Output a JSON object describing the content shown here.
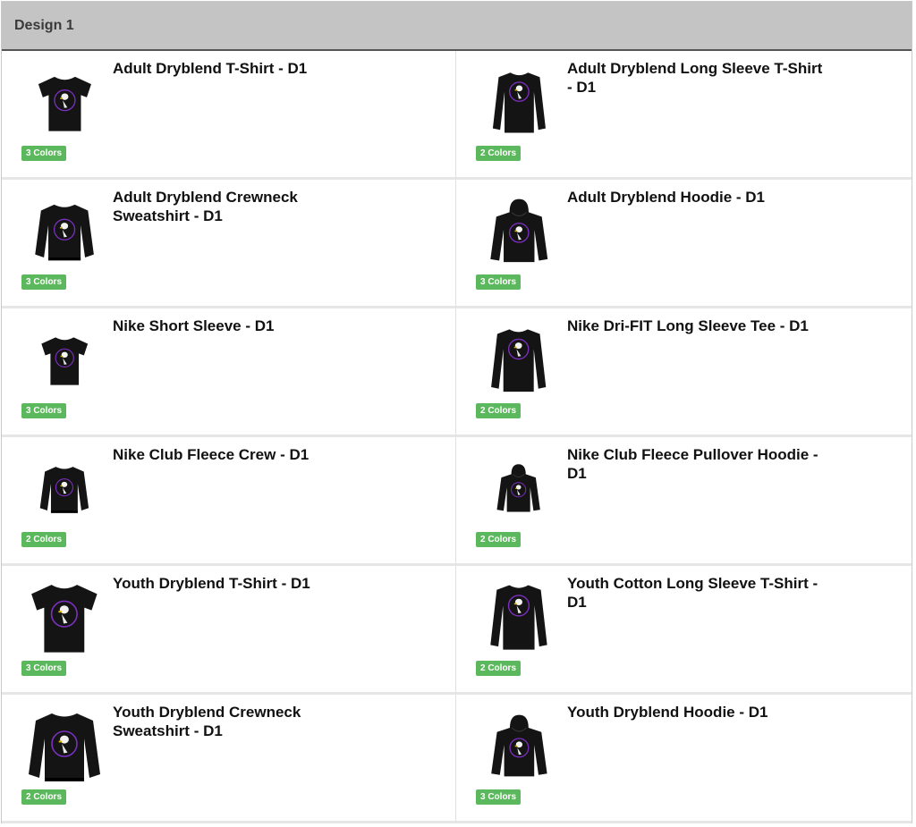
{
  "panel": {
    "title": "Design 1"
  },
  "colors": {
    "header_bg": "#c4c4c4",
    "badge_bg": "#5cb85c",
    "garment": "#141414",
    "logo_ring": "#7b2fbe"
  },
  "products": [
    {
      "title": "Adult Dryblend T-Shirt - D1",
      "colors": "3 Colors",
      "icon": "tshirt-icon"
    },
    {
      "title": "Adult Dryblend Long Sleeve T-Shirt - D1",
      "colors": "2 Colors",
      "icon": "longsleeve-icon"
    },
    {
      "title": "Adult Dryblend Crewneck Sweatshirt - D1",
      "colors": "3 Colors",
      "icon": "crewneck-icon"
    },
    {
      "title": "Adult Dryblend Hoodie - D1",
      "colors": "3 Colors",
      "icon": "hoodie-icon"
    },
    {
      "title": "Nike Short Sleeve - D1",
      "colors": "3 Colors",
      "icon": "tshirt-icon"
    },
    {
      "title": "Nike Dri-FIT Long Sleeve Tee - D1",
      "colors": "2 Colors",
      "icon": "longsleeve-icon"
    },
    {
      "title": "Nike Club Fleece Crew - D1",
      "colors": "2 Colors",
      "icon": "crewneck-icon"
    },
    {
      "title": "Nike Club Fleece Pullover Hoodie - D1",
      "colors": "2 Colors",
      "icon": "hoodie-icon"
    },
    {
      "title": "Youth Dryblend T-Shirt - D1",
      "colors": "3 Colors",
      "icon": "tshirt-icon"
    },
    {
      "title": "Youth Cotton Long Sleeve T-Shirt - D1",
      "colors": "2 Colors",
      "icon": "longsleeve-icon"
    },
    {
      "title": "Youth Dryblend Crewneck Sweatshirt - D1",
      "colors": "2 Colors",
      "icon": "crewneck-icon"
    },
    {
      "title": "Youth Dryblend Hoodie - D1",
      "colors": "3 Colors",
      "icon": "hoodie-icon"
    }
  ]
}
